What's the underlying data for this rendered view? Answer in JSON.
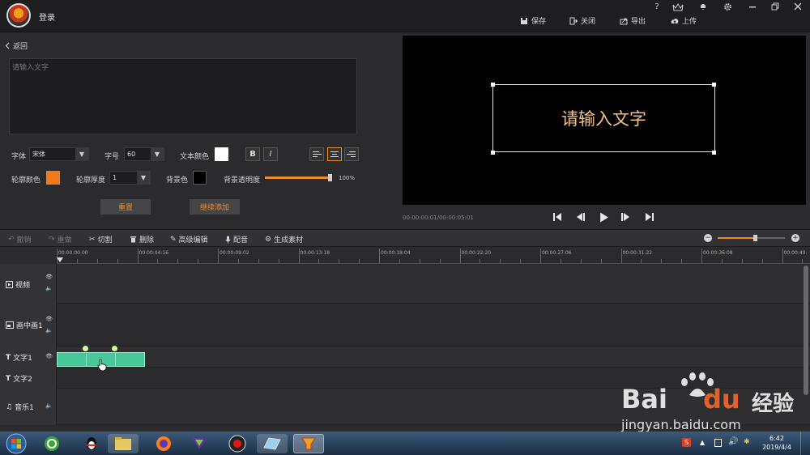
{
  "app": {
    "login": "登录",
    "top_buttons": [
      {
        "label": "保存",
        "icon": "save-icon"
      },
      {
        "label": "关闭",
        "icon": "close-icon"
      },
      {
        "label": "导出",
        "icon": "export-icon"
      },
      {
        "label": "上传",
        "icon": "upload-icon"
      }
    ],
    "sys_icons": [
      "help-icon",
      "vip-icon",
      "bell-icon",
      "gear-icon",
      "minimize-icon",
      "restore-icon",
      "close-window-icon"
    ],
    "help": "?",
    "vip": "VIP"
  },
  "editor": {
    "back": "返回",
    "text_placeholder": "请输入文字",
    "font_label": "字体",
    "font_value": "宋体",
    "size_label": "字号",
    "size_value": "60",
    "text_color_label": "文本颜色",
    "text_color": "#ffffff",
    "bold": "B",
    "italic": "I",
    "outline_color_label": "轮廓颜色",
    "outline_color": "#f07a1c",
    "outline_width_label": "轮廓厚度",
    "outline_width_value": "1",
    "bg_color_label": "背景色",
    "bg_color": "#000000",
    "bg_opacity_label": "背景透明度",
    "bg_opacity": 1.0,
    "bg_opacity_text": "100%",
    "reset": "重置",
    "continue_add": "继续添加",
    "accent": "#f08a2c"
  },
  "preview": {
    "text": "请输入文字",
    "timecode": "00:00:00:01/00:00:05:01"
  },
  "toolbar": {
    "undo": "撤销",
    "redo": "重做",
    "cut": "切割",
    "delete": "删除",
    "advanced": "高级编辑",
    "dub": "配音",
    "generate": "生成素材",
    "zoom_level": 0.55
  },
  "timeline": {
    "ticks": [
      "00:00:00:00",
      "00:00:04:16",
      "00:00:09:02",
      "00:00:13:18",
      "00:00:18:04",
      "00:00:22:20",
      "00:00:27:06",
      "00:00:31:22",
      "00:00:36:08",
      "00:00:40:"
    ],
    "tracks": [
      {
        "label": "视频",
        "icon": "video-icon"
      },
      {
        "label": "画中画1",
        "icon": "pip-icon"
      },
      {
        "label": "文字1",
        "icon": "text-icon"
      },
      {
        "label": "文字2",
        "icon": "text-icon"
      },
      {
        "label": "音乐1",
        "icon": "music-icon"
      }
    ]
  },
  "taskbar": {
    "clock_time": "6:42",
    "clock_date": "2019/4/4"
  },
  "watermark": {
    "brand": "Bai",
    "brand2": "du",
    "cn": "经验",
    "url": "jingyan.baidu.com"
  }
}
